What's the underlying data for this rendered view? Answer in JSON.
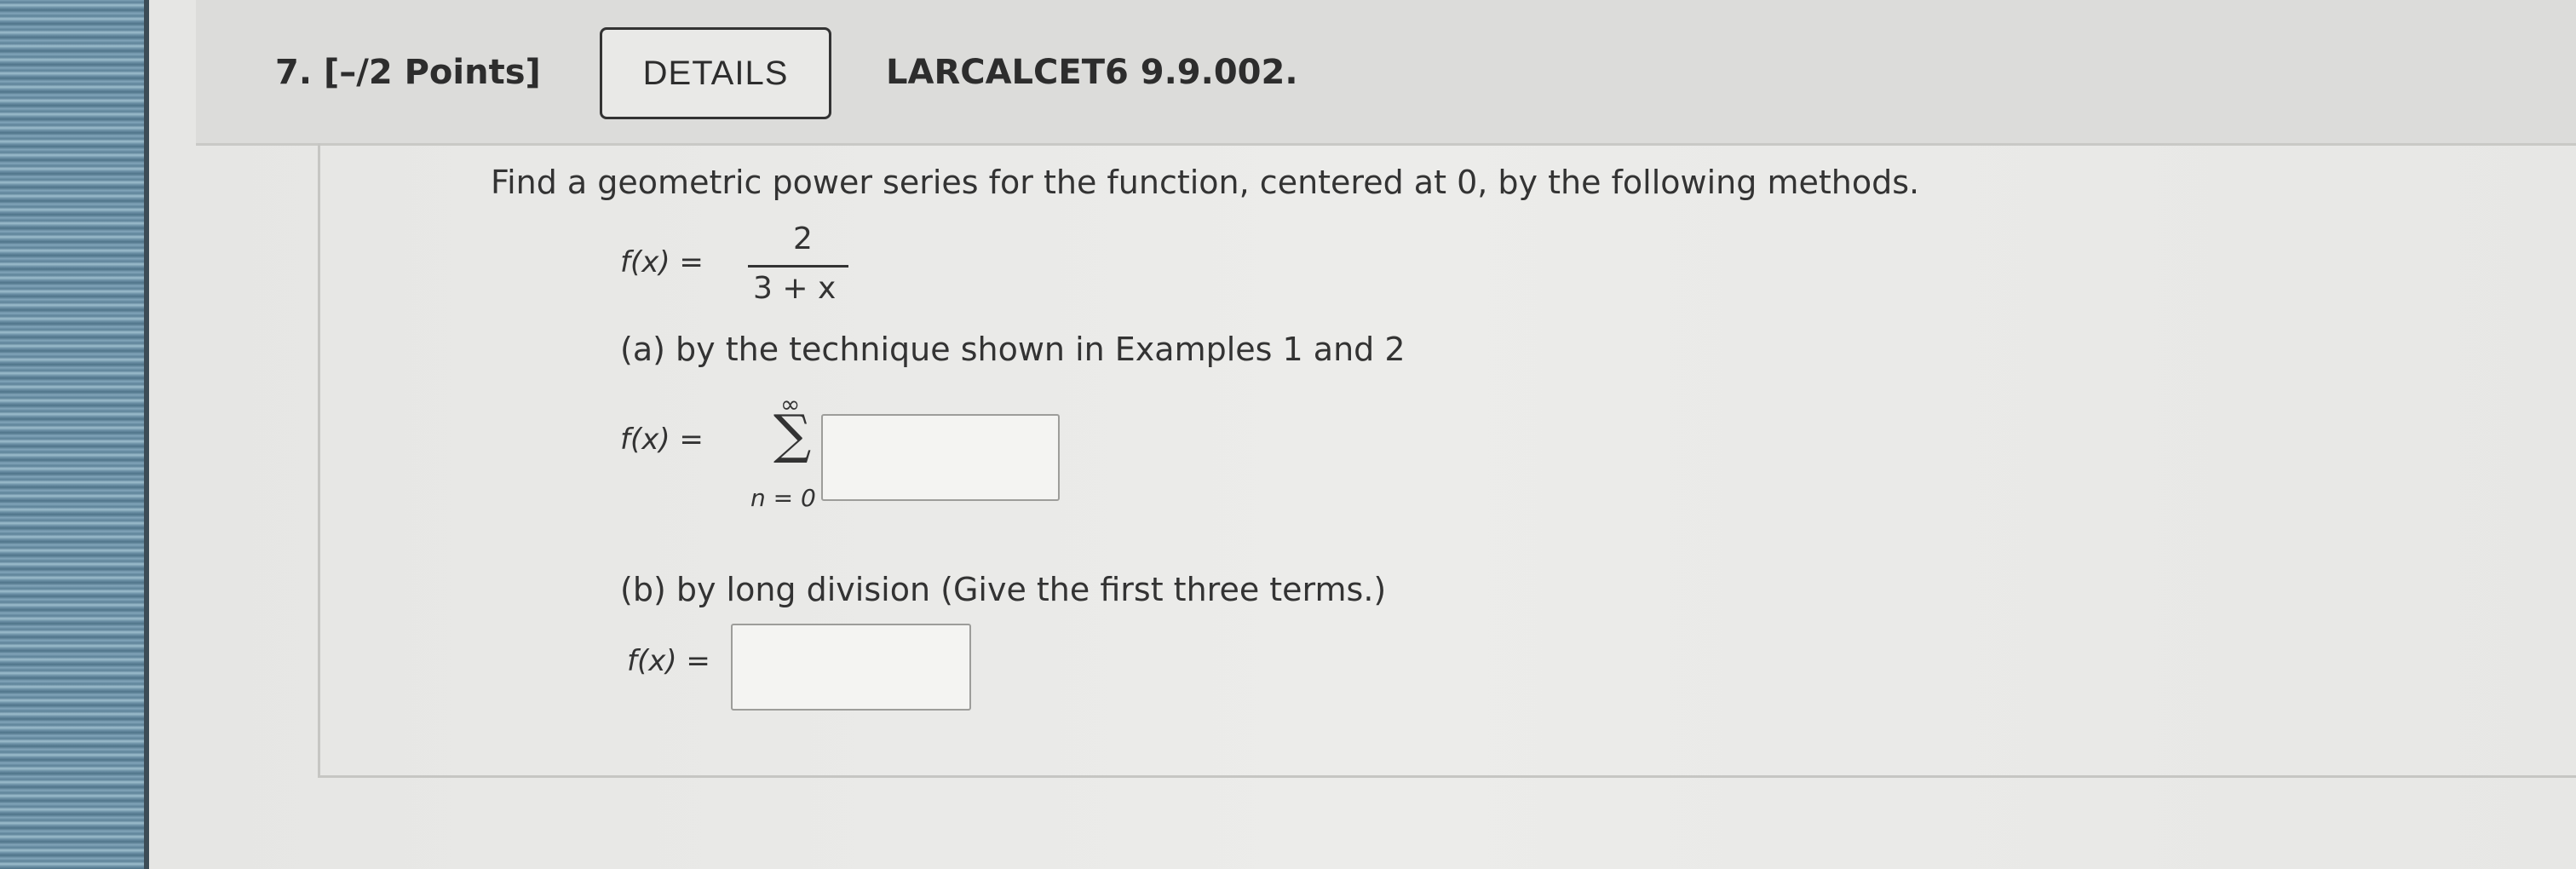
{
  "question": {
    "number_label": "7.  [–/2 Points]",
    "details_label": "DETAILS",
    "reference": "LARCALCET6 9.9.002."
  },
  "problem": {
    "prompt": "Find a geometric power series for the function, centered at 0, by the following methods.",
    "function_lhs": "f(x)  =",
    "numerator": "2",
    "denominator": "3 + x",
    "part_a_label": "(a) by the technique shown in Examples 1 and 2",
    "part_a_lhs": "f(x)  =",
    "sum_upper": "∞",
    "sum_symbol": "∑",
    "sum_lower": "n  =  0",
    "part_a_answer": "",
    "part_b_label": "(b) by long division (Give the first three terms.)",
    "part_b_lhs": "f(x)  =",
    "part_b_answer": ""
  },
  "colors": {
    "screen_bg": "#e9e9e7",
    "header_bg": "#dcdcda",
    "text": "#333333"
  }
}
